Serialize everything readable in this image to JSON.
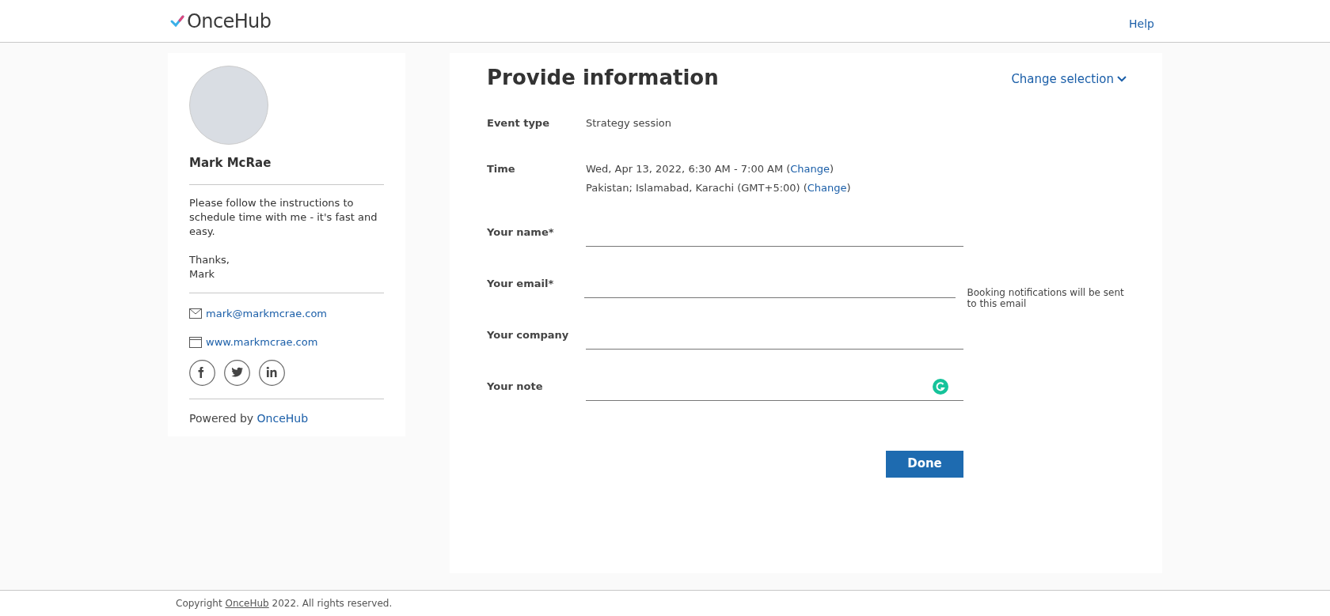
{
  "header": {
    "logo": "OnceHub",
    "help": "Help"
  },
  "profile": {
    "name": "Mark McRae",
    "message": [
      "Please follow the instructions to schedule time with me - it's fast and easy.",
      "Thanks,\nMark"
    ],
    "contacts": [
      {
        "kind": "email",
        "text": "mark@markmcrae.com"
      },
      {
        "kind": "web",
        "text": "www.markmcrae.com"
      }
    ],
    "social": [
      {
        "kind": "facebook"
      },
      {
        "kind": "twitter"
      },
      {
        "kind": "linkedin"
      }
    ],
    "powered_by": "Powered by",
    "powered_link": "OnceHub"
  },
  "form": {
    "title": "Provide information",
    "change_selection": "Change selection",
    "details": [
      {
        "label": "Event type",
        "lines": [
          {
            "text": "Strategy session"
          }
        ]
      },
      {
        "label": "Time",
        "lines": [
          {
            "text": "Wed, Apr 13, 2022, 6:30 AM - 7:00 AM",
            "open": "(",
            "link": "Change",
            "close": ")"
          },
          {
            "text": "Pakistan; Islamabad, Karachi (GMT+5:00)",
            "open": "(",
            "link": "Change",
            "close": ")"
          }
        ]
      }
    ],
    "fields": [
      {
        "label": "Your name*"
      },
      {
        "label": "Your email*",
        "hint": "Booking notifications will be sent to this email"
      },
      {
        "label": "Your company"
      },
      {
        "label": "Your note",
        "grammar_icon": true
      }
    ],
    "submit": "Done"
  },
  "footer": {
    "before": "Copyright",
    "link": "OnceHub",
    "after": "2022. All rights reserved."
  }
}
